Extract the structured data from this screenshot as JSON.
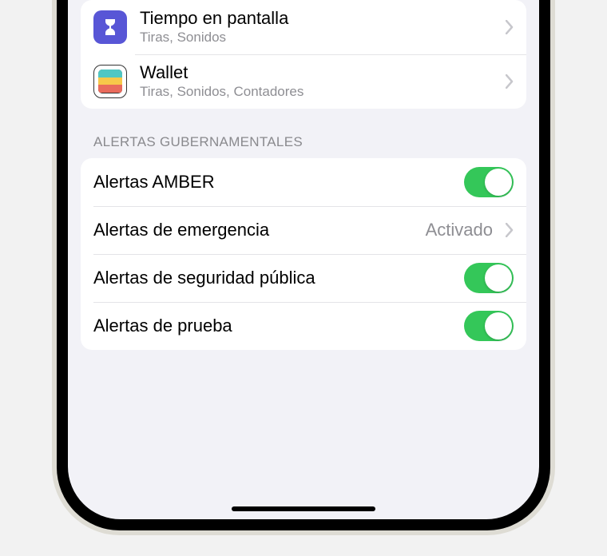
{
  "apps": [
    {
      "title": "Tiempo en pantalla",
      "subtitle": "Tiras, Sonidos",
      "icon": "hourglass"
    },
    {
      "title": "Wallet",
      "subtitle": "Tiras, Sonidos, Contadores",
      "icon": "wallet"
    }
  ],
  "section_header": "ALERTAS GUBERNAMENTALES",
  "alerts": [
    {
      "label": "Alertas AMBER",
      "type": "toggle",
      "on": true
    },
    {
      "label": "Alertas de emergencia",
      "type": "link",
      "value": "Activado"
    },
    {
      "label": "Alertas de seguridad pública",
      "type": "toggle",
      "on": true
    },
    {
      "label": "Alertas de prueba",
      "type": "toggle",
      "on": true
    }
  ]
}
